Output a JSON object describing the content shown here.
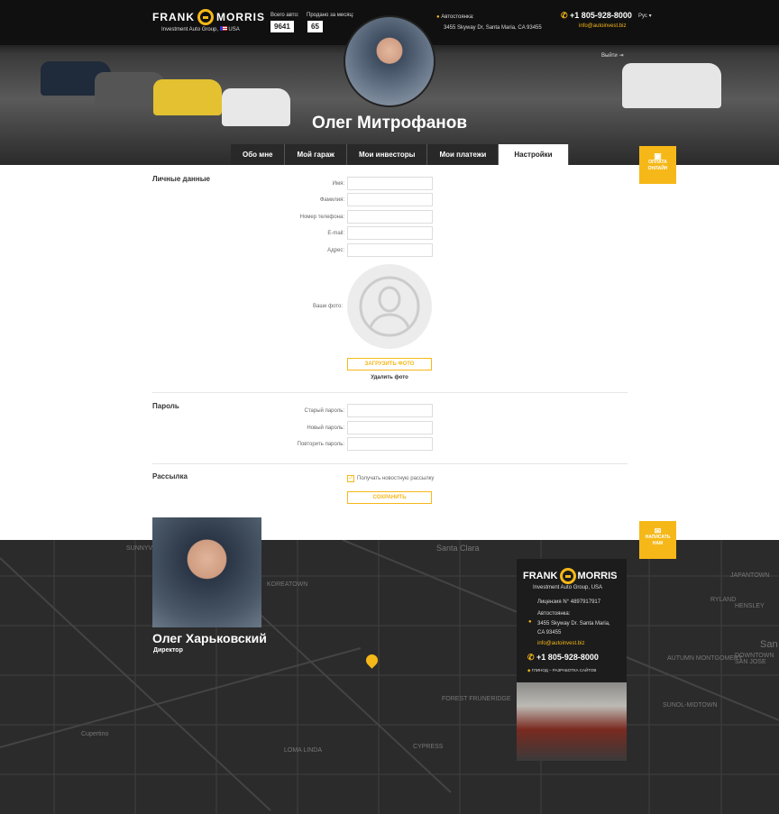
{
  "header": {
    "brand_left": "FRANK",
    "brand_right": "MORRIS",
    "subtitle": "Investment Auto Group,",
    "country": "USA",
    "total_label": "Всего авто:",
    "total_value": "9641",
    "sold_label": "Продано за месяц:",
    "sold_value": "65",
    "parking_label": "Автостоянка:",
    "parking_address": "3455 Skyway Dr, Santa Maria, CA 93455",
    "phone": "+1 805-928-8000",
    "email": "info@autoinvest.biz",
    "language": "Рус",
    "logout": "Выйти"
  },
  "profile": {
    "name": "Олег Митрофанов"
  },
  "tabs": [
    {
      "label": "Обо мне"
    },
    {
      "label": "Мой гараж"
    },
    {
      "label": "Мои инвесторы"
    },
    {
      "label": "Мои платежи"
    },
    {
      "label": "Настройки",
      "active": true
    }
  ],
  "side_buttons": {
    "pay_line1": "ОПЛАТА",
    "pay_line2": "ОНЛАЙН",
    "write_line1": "НАПИСАТЬ",
    "write_line2": "НАМ"
  },
  "personal": {
    "title": "Личные данные",
    "fields": [
      {
        "label": "Имя:",
        "value": ""
      },
      {
        "label": "Фамилия:",
        "value": ""
      },
      {
        "label": "Номер телефона:",
        "value": ""
      },
      {
        "label": "E-mail:",
        "value": ""
      },
      {
        "label": "Адрес:",
        "value": ""
      }
    ],
    "photo_label": "Ваше фото:",
    "upload": "ЗАГРУЗИТЬ ФОТО",
    "delete": "Удалить фото"
  },
  "password": {
    "title": "Пароль",
    "fields": [
      {
        "label": "Старый пароль:",
        "value": ""
      },
      {
        "label": "Новый пароль:",
        "value": ""
      },
      {
        "label": "Повторить пароль:",
        "value": ""
      }
    ]
  },
  "newsletter": {
    "title": "Рассылка",
    "checkbox": "Получать новостную рассылку",
    "checked": true,
    "save": "СОХРАНИТЬ"
  },
  "footer": {
    "director_name": "Олег Харьковский",
    "director_role": "Директор",
    "card": {
      "license": "Лицензия N° 4897917917",
      "parking_label": "Автостоянка:",
      "address1": "3455 Skyway Dr. Santa Maria,",
      "address2": "CA 93455",
      "email": "info@autoinvest.biz",
      "phone": "+1 805-928-8000",
      "dev": "ГЛИНОД – РАЗРАБОТКА САЙТОВ"
    },
    "map_labels": [
      "SUNNYVALE",
      "KOREATOWN",
      "Santa Clara",
      "JAPANTOWN",
      "RYLAND",
      "HENSLEY",
      "AUTUMN MONTGOMERY",
      "DOWNTOWN SAN JOSE",
      "SUNOL-MIDTOWN",
      "Cupertino",
      "LOMA LINDA",
      "FOREST FRUNERIDGE",
      "CYPRESS",
      "San"
    ]
  },
  "colors": {
    "accent": "#f6b818",
    "dark": "#1c1c1c"
  }
}
